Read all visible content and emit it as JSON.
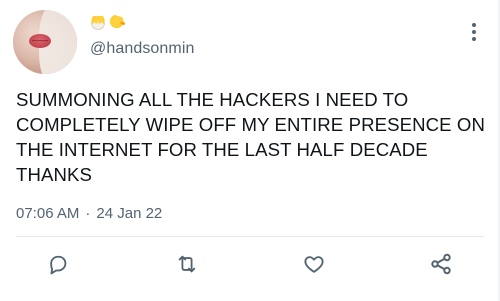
{
  "tweet": {
    "username": "@handsonmin",
    "text": "SUMMONING ALL THE HACKERS I NEED TO COMPLETELY WIPE OFF MY ENTIRE PRESENCE ON THE INTERNET FOR THE LAST HALF DECADE THANKS",
    "time": "07:06 AM",
    "separator": "·",
    "date": "24 Jan 22"
  },
  "icons": {
    "display_name_emojis": [
      "hatching-chick",
      "front-facing-chick"
    ],
    "actions": [
      "reply-icon",
      "retweet-icon",
      "like-icon",
      "share-icon"
    ],
    "more": "more-vertical-icon"
  },
  "colors": {
    "text_primary": "#0f1419",
    "text_secondary": "#536471",
    "divider": "#e6eaee",
    "icon": "#536471",
    "background": "#ffffff"
  }
}
